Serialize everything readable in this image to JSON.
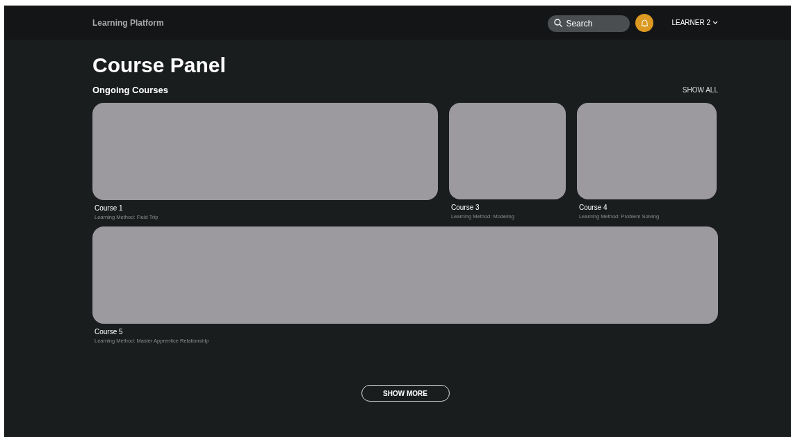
{
  "brand": "Learning Platform",
  "search": {
    "placeholder": "Search"
  },
  "user": {
    "name": "LEARNER 2"
  },
  "title": "Course Panel",
  "section": {
    "title": "Ongoing Courses",
    "action": "SHOW ALL"
  },
  "course_rows": [
    [
      {
        "kind": "wide",
        "name": "Course 1",
        "method": "Learning Method: Field Trip"
      },
      {
        "kind": "narrow",
        "name": "Course 3",
        "method": "Learning Method: Modeling"
      },
      {
        "kind": "medium",
        "name": "Course 4",
        "method": "Learning Method: Problem Solving"
      }
    ],
    [
      {
        "kind": "full",
        "name": "Course 5",
        "method": "Learning Method: Master Apprentice Relationship"
      }
    ]
  ],
  "more_button": "SHOW MORE"
}
